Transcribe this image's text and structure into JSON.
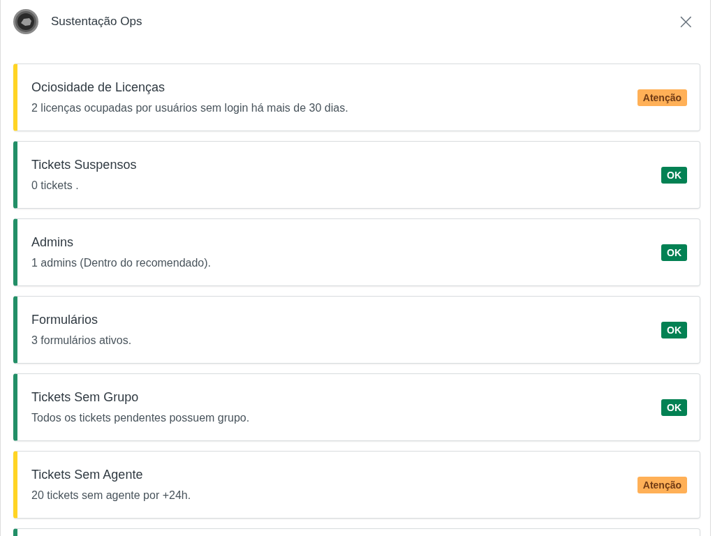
{
  "header": {
    "title": "Sustentação Ops",
    "close": "×"
  },
  "checks": [
    {
      "title": "Ociosidade de Licenças",
      "description": "2 licenças ocupadas por usuários sem login há mais de 30 dias.",
      "kind": "warning",
      "badge": "Atenção"
    },
    {
      "title": "Tickets Suspensos",
      "description": "0 tickets .",
      "kind": "ok",
      "badge": "OK"
    },
    {
      "title": "Admins",
      "description": "1 admins (Dentro do recomendado).",
      "kind": "ok",
      "badge": "OK"
    },
    {
      "title": "Formulários",
      "description": "3 formulários ativos.",
      "kind": "ok",
      "badge": "OK"
    },
    {
      "title": "Tickets Sem Grupo",
      "description": "Todos os tickets pendentes possuem grupo.",
      "kind": "ok",
      "badge": "OK"
    },
    {
      "title": "Tickets Sem Agente",
      "description": "20 tickets sem agente por +24h.",
      "kind": "warning",
      "badge": "Atenção"
    },
    {
      "kind": "ok"
    }
  ]
}
